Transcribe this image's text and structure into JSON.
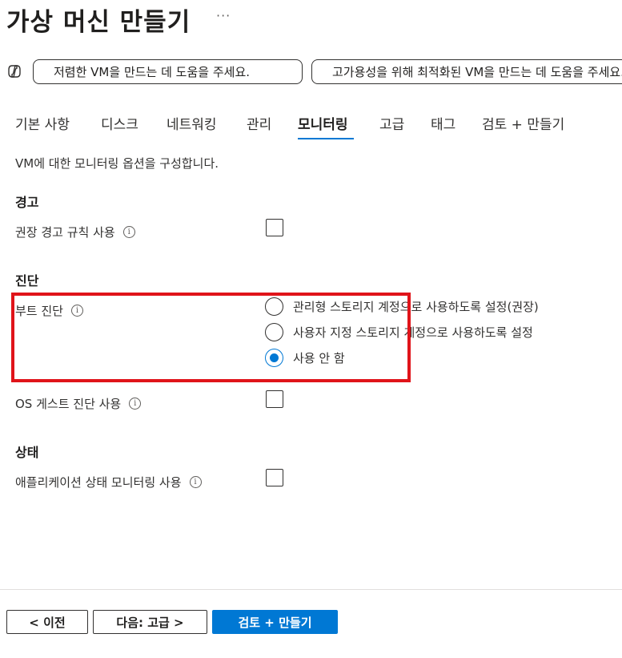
{
  "header": {
    "title": "가상 머신 만들기",
    "more_label": "···"
  },
  "copilot": {
    "icon": "copilot-icon",
    "suggestions": [
      "저렴한 VM을 만드는 데 도움을 주세요.",
      "고가용성을 위해 최적화된 VM을 만드는 데 도움을 주세요."
    ]
  },
  "tabs": [
    {
      "label": "기본 사항",
      "active": false
    },
    {
      "label": "디스크",
      "active": false
    },
    {
      "label": "네트워킹",
      "active": false
    },
    {
      "label": "관리",
      "active": false
    },
    {
      "label": "모니터링",
      "active": true
    },
    {
      "label": "고급",
      "active": false
    },
    {
      "label": "태그",
      "active": false
    },
    {
      "label": "검토 + 만들기",
      "active": false
    }
  ],
  "description": "VM에 대한 모니터링 옵션을 구성합니다.",
  "alerts": {
    "heading": "경고",
    "recommended_rules_label": "권장 경고 규칙 사용",
    "recommended_rules_checked": false
  },
  "diagnostics": {
    "heading": "진단",
    "boot_label": "부트 진단",
    "boot_options": [
      {
        "label": "관리형 스토리지 계정으로 사용하도록 설정(권장)",
        "selected": false
      },
      {
        "label": "사용자 지정 스토리지 계정으로 사용하도록 설정",
        "selected": false
      },
      {
        "label": "사용 안 함",
        "selected": true
      }
    ],
    "os_guest_label": "OS 게스트 진단 사용",
    "os_guest_checked": false
  },
  "health": {
    "heading": "상태",
    "app_health_label": "애플리케이션 상태 모니터링 사용",
    "app_health_checked": false
  },
  "footer": {
    "prev_label": "< 이전",
    "next_label": "다음: 고급 >",
    "review_label": "검토 + 만들기"
  },
  "colors": {
    "accent": "#0078d4",
    "highlight_border": "#e0141a"
  }
}
